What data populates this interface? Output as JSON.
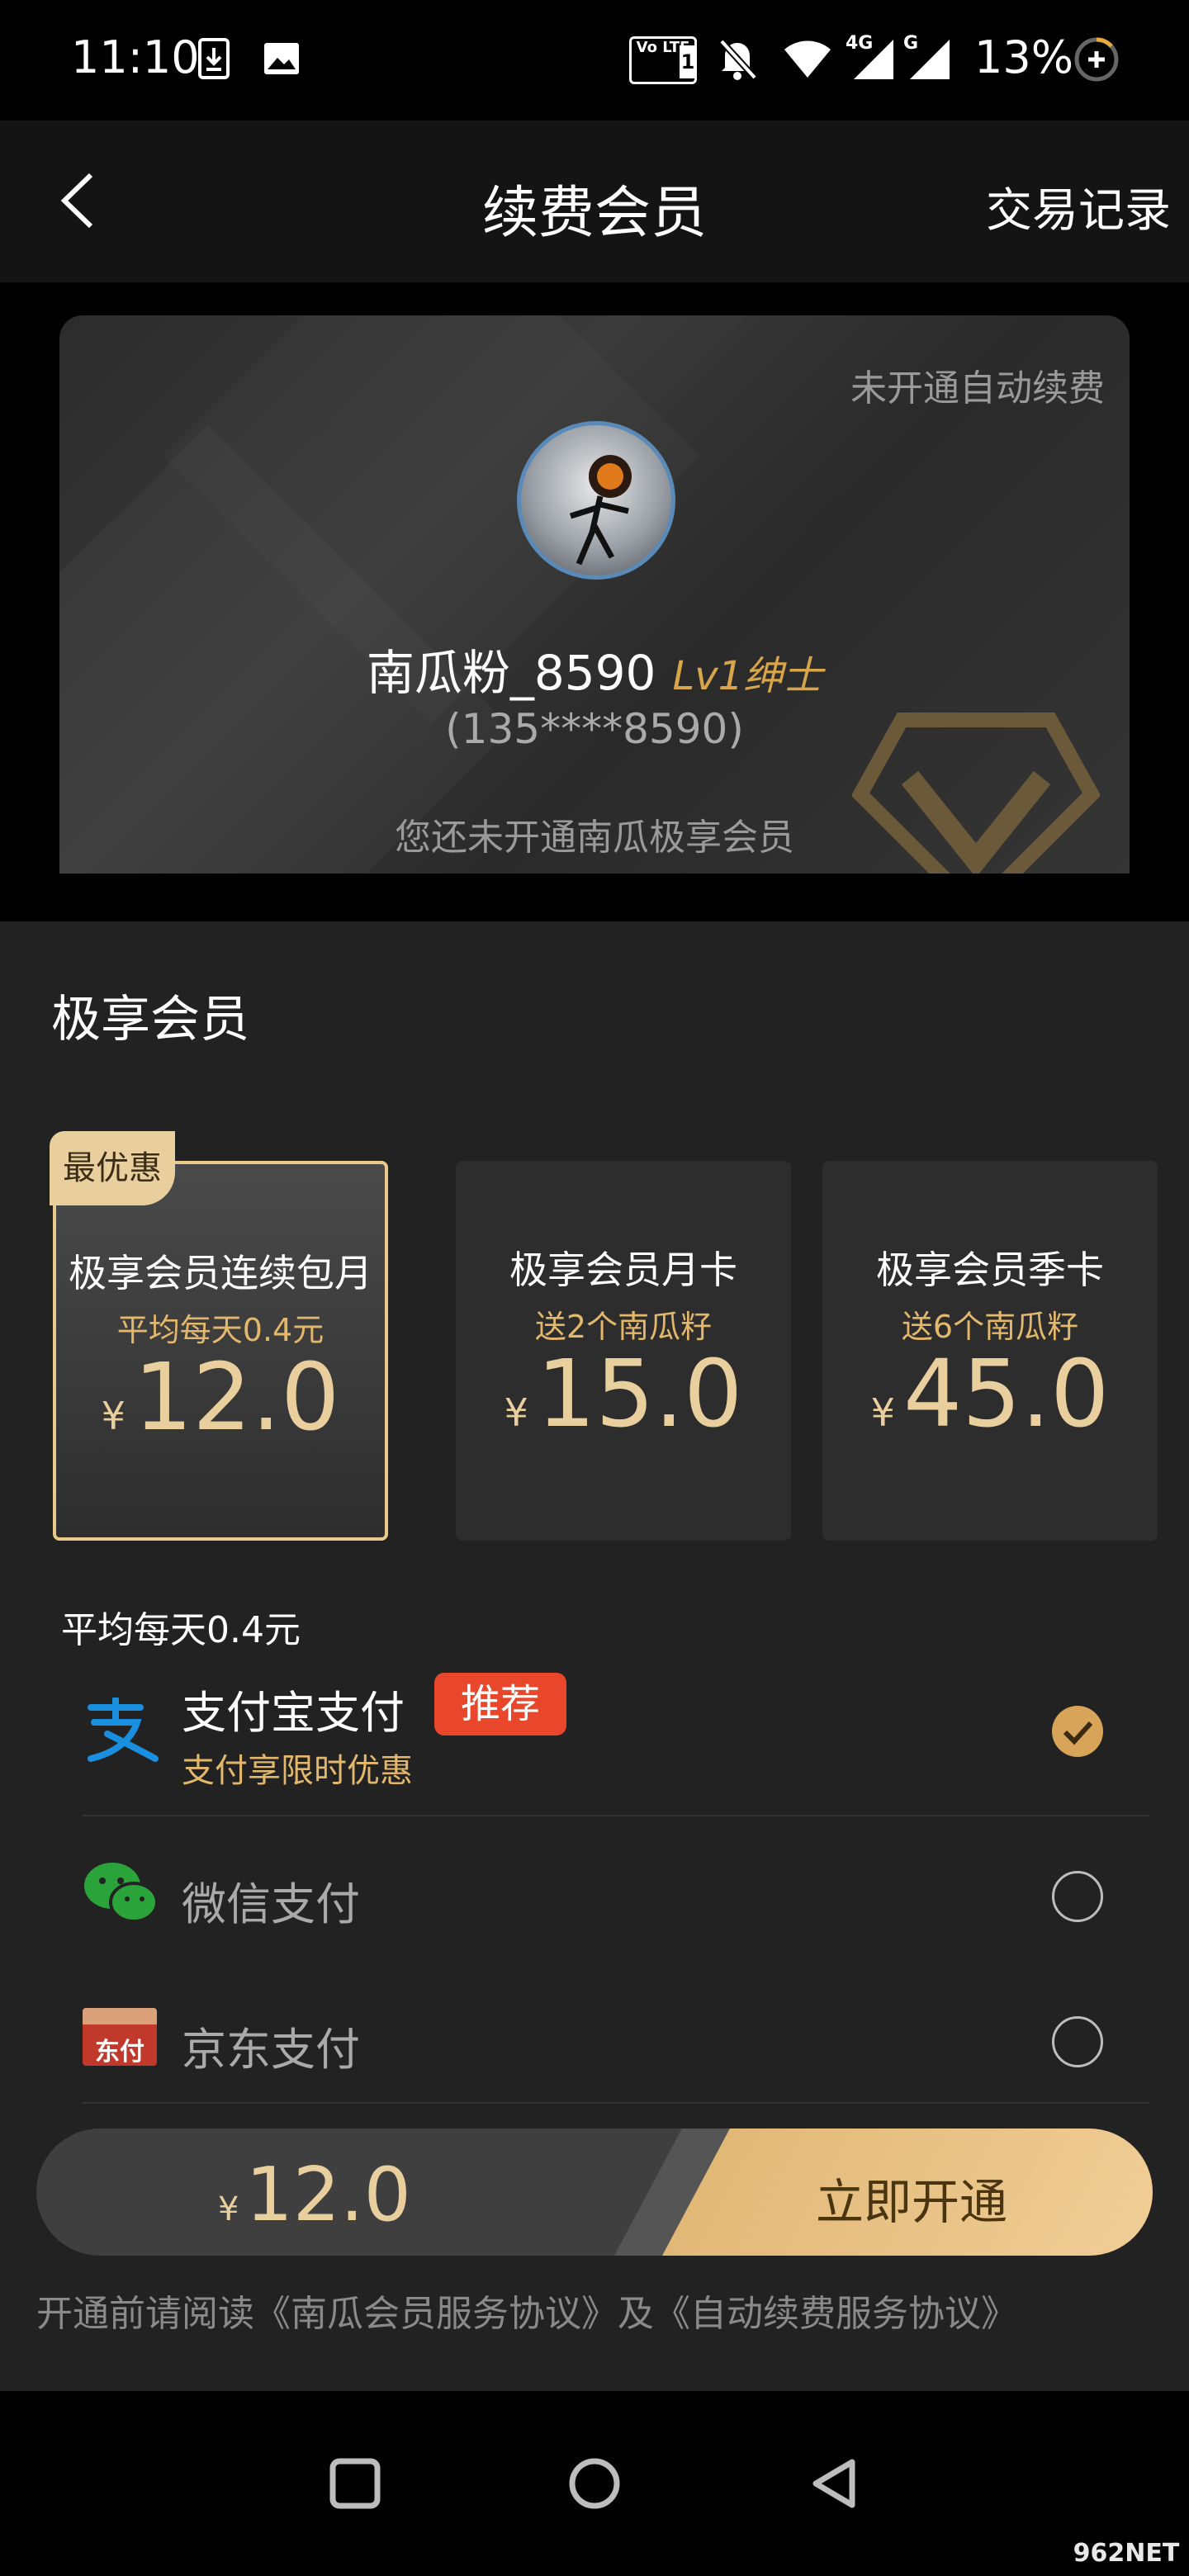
{
  "status_bar": {
    "time": "11:10",
    "volte_label": "Vo LTE",
    "sim_number": "1",
    "network_4g": "4G",
    "network_g": "G",
    "battery": "13%",
    "icons": [
      "download-icon",
      "image-icon",
      "volte-icon",
      "mute-icon",
      "wifi-icon",
      "signal-4g-icon",
      "signal-g-icon",
      "battery-saver-icon"
    ]
  },
  "header": {
    "title": "续费会员",
    "records_label": "交易记录",
    "back_icon": "chevron-left-icon"
  },
  "member_card": {
    "auto_renew_status": "未开通自动续费",
    "username": "南瓜粉_8590",
    "level": "Lv1绅士",
    "phone": "(135****8590)",
    "note": "您还未开通南瓜极享会员"
  },
  "plans_section": {
    "title": "极享会员",
    "best_badge": "最优惠",
    "currency": "¥",
    "plans": [
      {
        "name": "极享会员连续包月",
        "subtitle": "平均每天0.4元",
        "price": "12.0",
        "selected": true
      },
      {
        "name": "极享会员月卡",
        "subtitle": "送2个南瓜籽",
        "price": "15.0",
        "selected": false
      },
      {
        "name": "极享会员季卡",
        "subtitle": "送6个南瓜籽",
        "price": "45.0",
        "selected": false
      }
    ]
  },
  "payment": {
    "avg_note": "平均每天0.4元",
    "methods": [
      {
        "name": "支付宝支付",
        "tag": "推荐",
        "promo": "支付享限时优惠",
        "icon": "alipay-icon",
        "selected": true
      },
      {
        "name": "微信支付",
        "icon": "wechat-icon",
        "selected": false
      },
      {
        "name": "京东支付",
        "icon": "jd-pay-icon",
        "jd_logo_text": "东付",
        "selected": false
      }
    ]
  },
  "pay_bar": {
    "currency": "¥",
    "price": "12.0",
    "cta": "立即开通"
  },
  "agreement": "开通前请阅读《南瓜会员服务协议》及《自动续费服务协议》",
  "watermark": "962NET",
  "colors": {
    "gold": "#e9cf9e",
    "accent_orange": "#d8a45a",
    "tag_red": "#e8472b",
    "alipay_blue": "#1a8fe0",
    "wechat_green": "#2aa33b",
    "sheet_bg": "#222222"
  }
}
